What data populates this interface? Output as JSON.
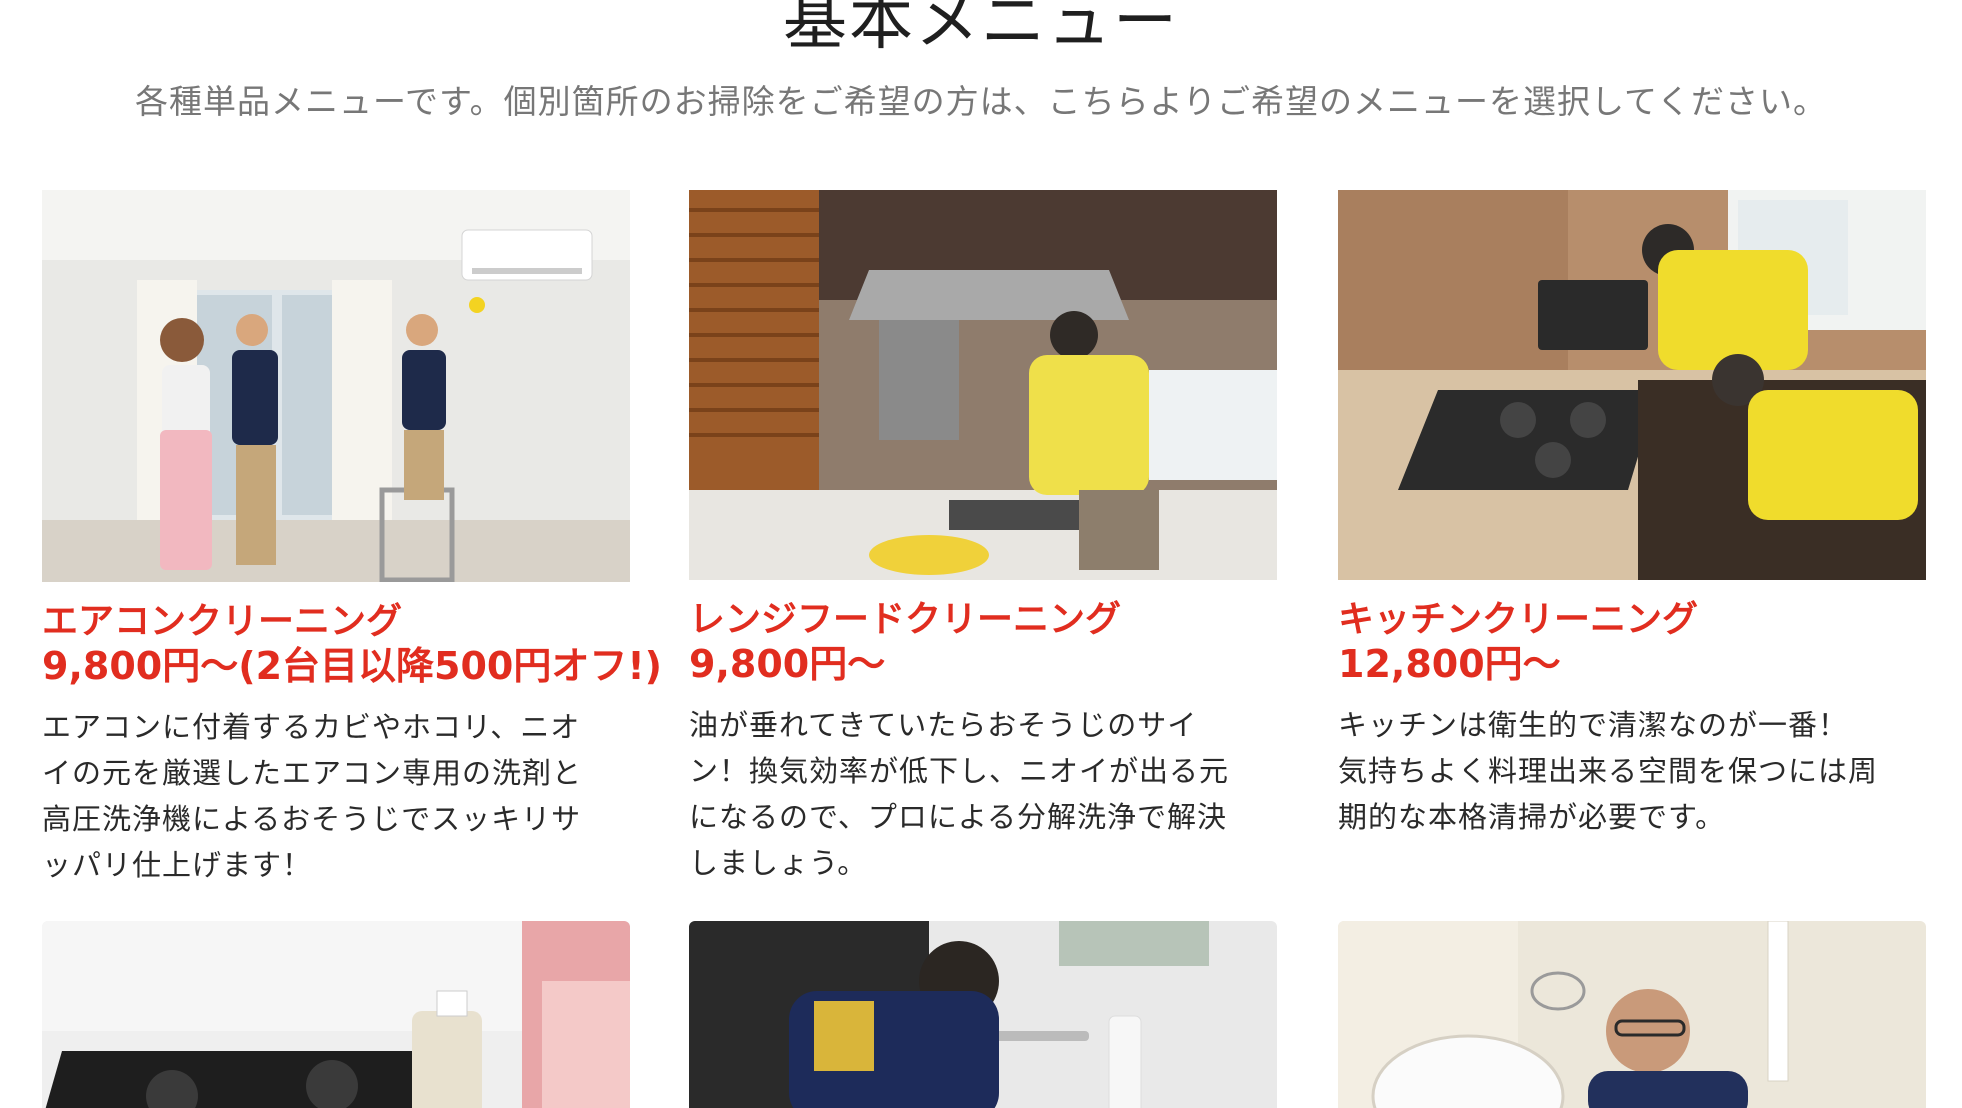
{
  "section": {
    "title": "基本メニュー",
    "subtitle": "各種単品メニューです。個別箇所のお掃除をご希望の方は、こちらよりご希望のメニューを選択してください。"
  },
  "cards": [
    {
      "title": "エアコンクリーニング",
      "price": "9,800円〜(2台目以降500円オフ!)",
      "desc_lines": [
        "エアコンに付着するカビやホコリ、ニオ",
        "イの元を厳選したエアコン専用の洗剤と",
        "高圧洗浄機によるおそうじでスッキリサ",
        "ッパリ仕上げます！"
      ],
      "photo_icon": "aircon-cleaning-photo"
    },
    {
      "title": "レンジフードクリーニング",
      "price": "9,800円〜",
      "desc_lines": [
        "油が垂れてきていたらおそうじのサイ",
        "ン！換気効率が低下し、ニオイが出る元",
        "になるので、プロによる分解洗浄で解決",
        "しましょう。"
      ],
      "photo_icon": "range-hood-cleaning-photo"
    },
    {
      "title": "キッチンクリーニング",
      "price": "12,800円〜",
      "desc_lines": [
        "キッチンは衛生的で清潔なのが一番！",
        "気持ちよく料理出来る空間を保つには周",
        "期的な本格清掃が必要です。"
      ],
      "photo_icon": "kitchen-cleaning-photo"
    },
    {
      "photo_icon": "stove-cleaning-photo"
    },
    {
      "photo_icon": "bathroom-cleaning-photo"
    },
    {
      "photo_icon": "toilet-cleaning-photo"
    }
  ],
  "colors": {
    "accent": "#e12d1f",
    "text": "#2a2a2a",
    "subtext": "#777777"
  }
}
